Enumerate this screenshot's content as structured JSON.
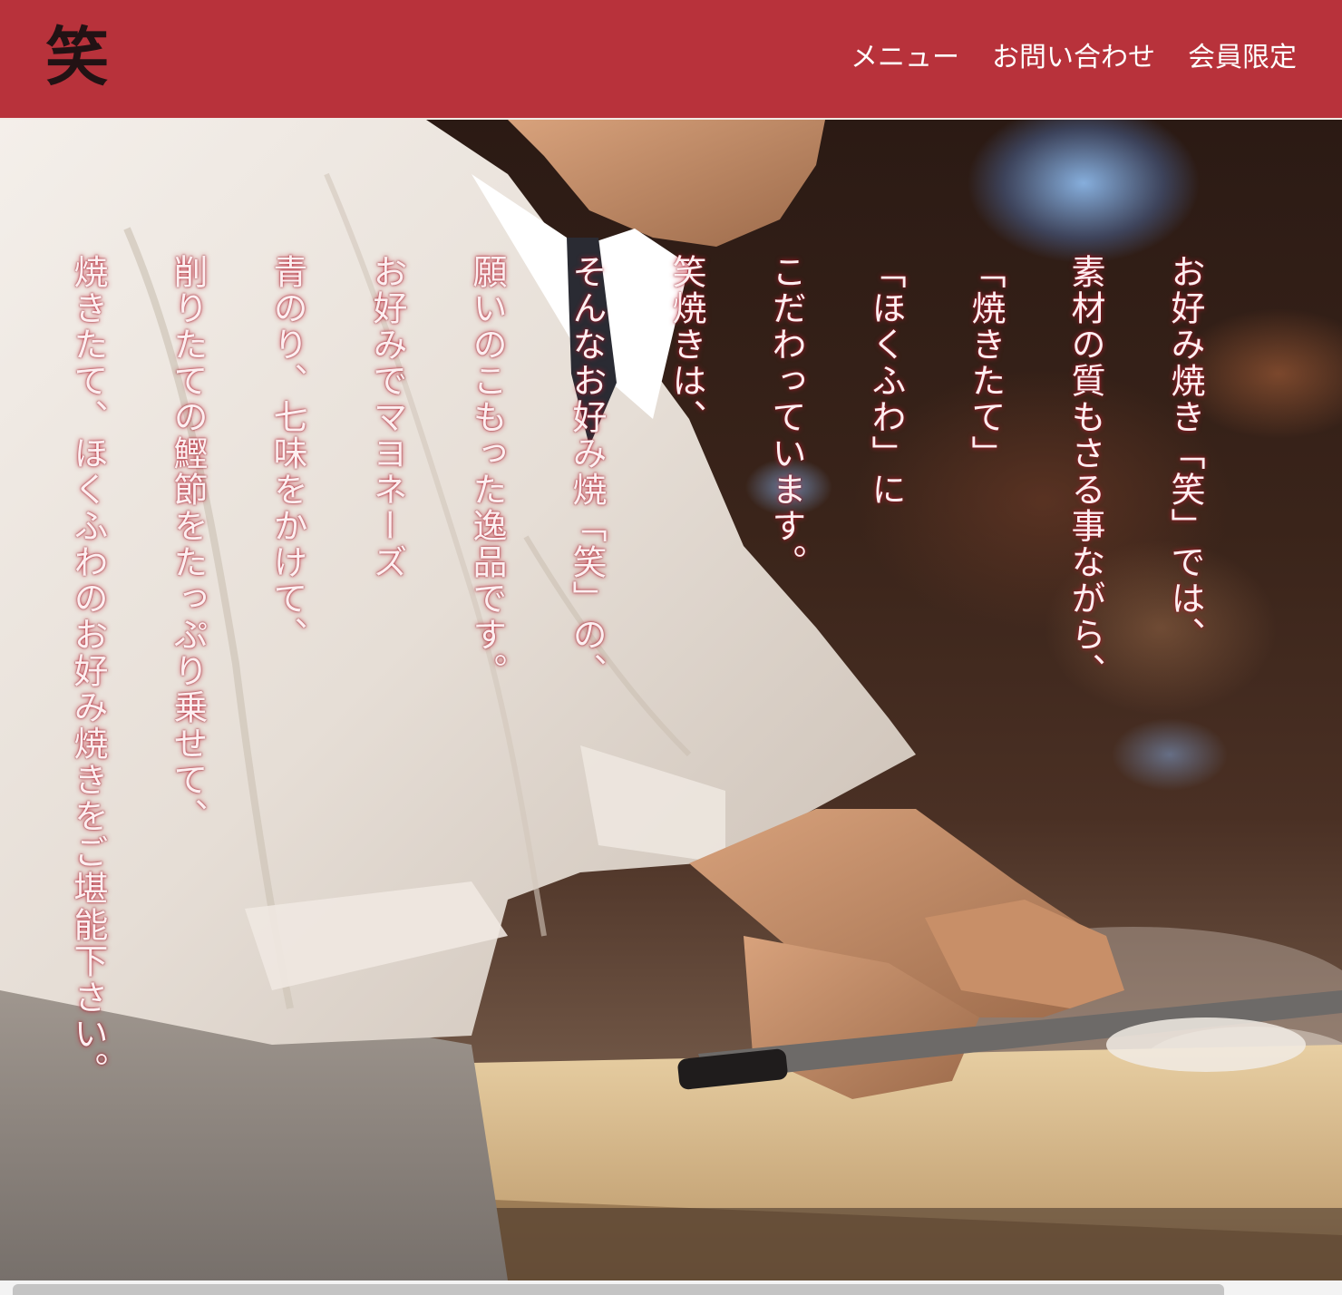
{
  "header": {
    "logo_text": "笑",
    "brand_color": "#b8323b",
    "nav": [
      {
        "label": "メニュー"
      },
      {
        "label": "お問い合わせ"
      },
      {
        "label": "会員限定"
      }
    ]
  },
  "hero": {
    "lines": [
      "お好み焼き「笑」では、",
      "素材の質もさる事ながら、",
      "「焼きたて」",
      "「ほくふわ」に",
      "こだわっています。",
      "笑焼きは、",
      "そんなお好み焼「笑」の、",
      "願いのこもった逸品です。",
      "お好みでマヨネーズ",
      "青のり、七味をかけて、",
      "削りたての鰹節をたっぷり乗せて、",
      "焼きたて、ほくふわのお好み焼きをご堪能下さい。"
    ]
  }
}
